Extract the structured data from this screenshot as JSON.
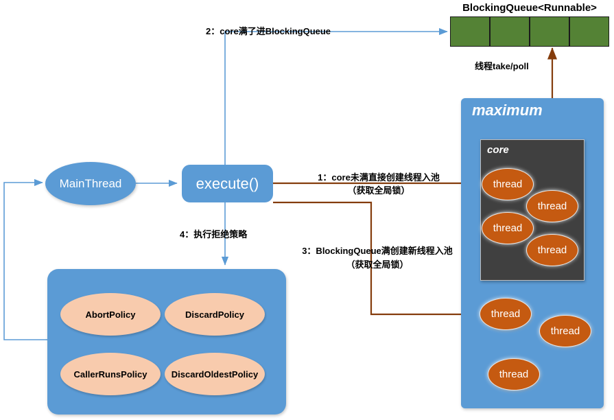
{
  "diagram": {
    "title": "Java ThreadPoolExecutor execution flow",
    "colors": {
      "blue": "#5B9BD5",
      "orange": "#C55A11",
      "peach": "#F8CBAD",
      "green": "#548235",
      "dark": "#404040",
      "brown_arrow": "#843C0C",
      "blue_arrow": "#5B9BD5"
    }
  },
  "queue": {
    "title": "BlockingQueue<Runnable>",
    "cells": [
      "",
      "",
      "",
      ""
    ]
  },
  "pool": {
    "maximum_label": "maximum",
    "core_label": "core",
    "core_threads": [
      {
        "label": "thread"
      },
      {
        "label": "thread"
      },
      {
        "label": "thread"
      },
      {
        "label": "thread"
      }
    ],
    "extra_threads": [
      {
        "label": "thread"
      },
      {
        "label": "thread"
      },
      {
        "label": "thread"
      }
    ]
  },
  "flow": {
    "main_thread": "MainThread",
    "execute": "execute()"
  },
  "arrows": {
    "step1": "1：core未满直接创建线程入池",
    "step1_sub": "（获取全局锁）",
    "step2": "2：core满了进BlockingQueue",
    "step3": "3：BlockingQueue满创建新线程入池",
    "step3_sub": "（获取全局锁）",
    "step4": "4：执行拒绝策略",
    "take_poll": "线程take/poll"
  },
  "policies": {
    "items": [
      {
        "label": "AbortPolicy"
      },
      {
        "label": "DiscardPolicy"
      },
      {
        "label": "CallerRunsPolicy"
      },
      {
        "label": "DiscardOldestPolicy"
      }
    ]
  }
}
